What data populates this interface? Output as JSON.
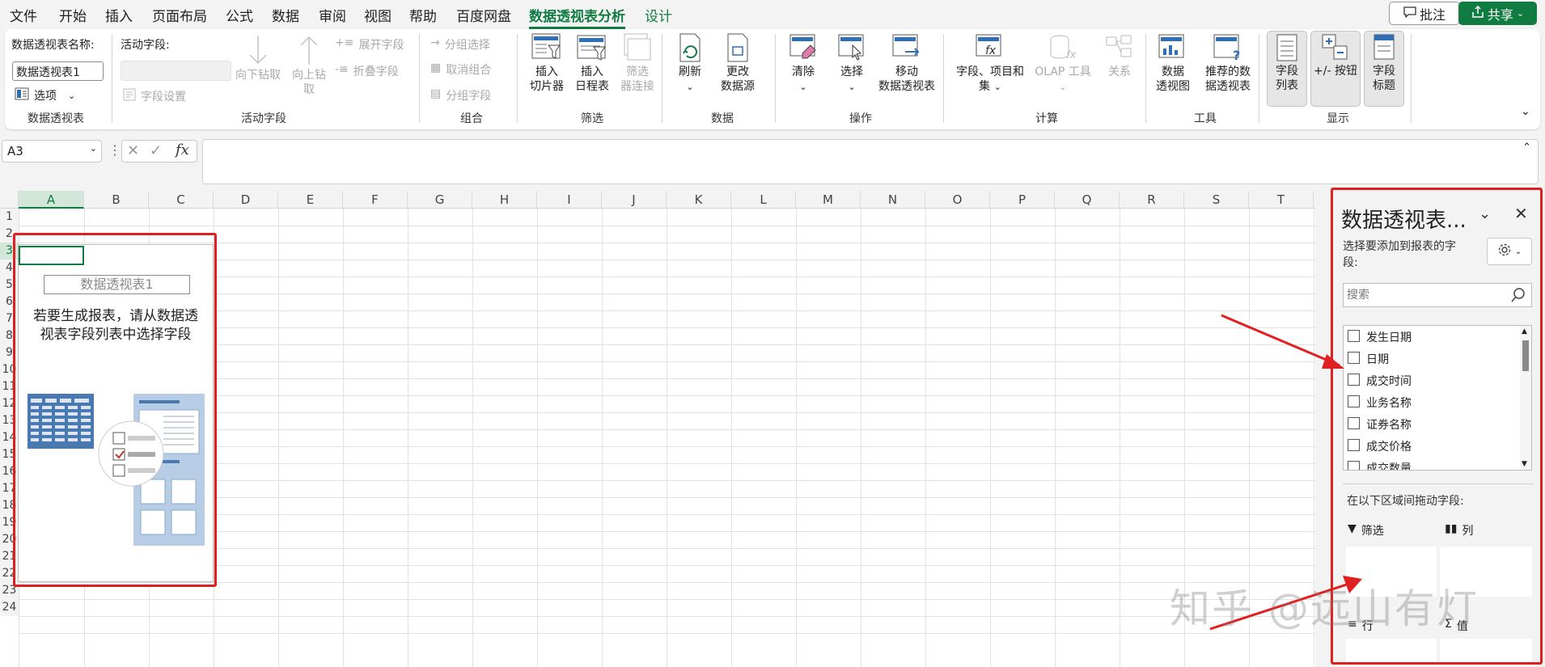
{
  "menu": {
    "items": [
      "文件",
      "开始",
      "插入",
      "页面布局",
      "公式",
      "数据",
      "审阅",
      "视图",
      "帮助",
      "百度网盘",
      "数据透视表分析",
      "设计"
    ],
    "active": "数据透视表分析",
    "comment_label": "批注",
    "share_label": "共享"
  },
  "ribbon": {
    "pivot_group": {
      "name_label": "数据透视表名称:",
      "name_value": "数据透视表1",
      "options_label": "选项",
      "group_label": "数据透视表"
    },
    "active_field_group": {
      "field_label": "活动字段:",
      "field_settings": "字段设置",
      "drill_down": "向下钻取",
      "drill_up_1": "向上钻",
      "drill_up_2": "取",
      "expand": "展开字段",
      "collapse": "折叠字段",
      "group_label": "活动字段"
    },
    "group_group": {
      "group_selection": "分组选择",
      "ungroup": "取消组合",
      "group_field": "分组字段",
      "group_label": "组合"
    },
    "filter_group": {
      "slicer_1": "插入",
      "slicer_2": "切片器",
      "timeline_1": "插入",
      "timeline_2": "日程表",
      "filter_conn_1": "筛选",
      "filter_conn_2": "器连接",
      "group_label": "筛选"
    },
    "data_group": {
      "refresh": "刷新",
      "change_1": "更改",
      "change_2": "数据源",
      "group_label": "数据"
    },
    "actions_group": {
      "clear": "清除",
      "select": "选择",
      "move_1": "移动",
      "move_2": "数据透视表",
      "group_label": "操作"
    },
    "calc_group": {
      "fields_1": "字段、项目和",
      "fields_2": "集",
      "olap": "OLAP 工具",
      "relations": "关系",
      "group_label": "计算"
    },
    "tools_group": {
      "chart_1": "数据",
      "chart_2": "透视图",
      "recommended_1": "推荐的数",
      "recommended_2": "据透视表",
      "group_label": "工具"
    },
    "show_group": {
      "field_list_1": "字段",
      "field_list_2": "列表",
      "buttons": "+/- 按钮",
      "headers_1": "字段",
      "headers_2": "标题",
      "group_label": "显示"
    }
  },
  "formula_bar": {
    "name_box": "A3",
    "fx": "fx"
  },
  "grid": {
    "columns": [
      "A",
      "B",
      "C",
      "D",
      "E",
      "F",
      "G",
      "H",
      "I",
      "J",
      "K",
      "L",
      "M",
      "N",
      "O",
      "P",
      "Q",
      "R",
      "S",
      "T"
    ],
    "rows": [
      "1",
      "2",
      "3",
      "4",
      "5",
      "6",
      "7",
      "8",
      "9",
      "10",
      "11",
      "12",
      "13",
      "14",
      "15",
      "16",
      "17",
      "18",
      "19",
      "20",
      "21",
      "22",
      "23",
      "24"
    ],
    "selected_column": "A"
  },
  "pivot_placeholder": {
    "name": "数据透视表1",
    "message_1": "若要生成报表，请从数据透",
    "message_2": "视表字段列表中选择字段"
  },
  "pane": {
    "title": "数据透视表...",
    "subtitle_1": "选择要添加到报表的字",
    "subtitle_2": "段:",
    "search_placeholder": "搜索",
    "fields": [
      "发生日期",
      "日期",
      "成交时间",
      "业务名称",
      "证券名称",
      "成交价格",
      "成交数量"
    ],
    "drag_label": "在以下区域间拖动字段:",
    "areas": {
      "filter": "筛选",
      "columns": "列",
      "rows": "行",
      "values": "值"
    }
  },
  "watermark": "知乎 @远山有灯",
  "colors": {
    "accent": "#107c41",
    "highlight": "#e02020"
  }
}
